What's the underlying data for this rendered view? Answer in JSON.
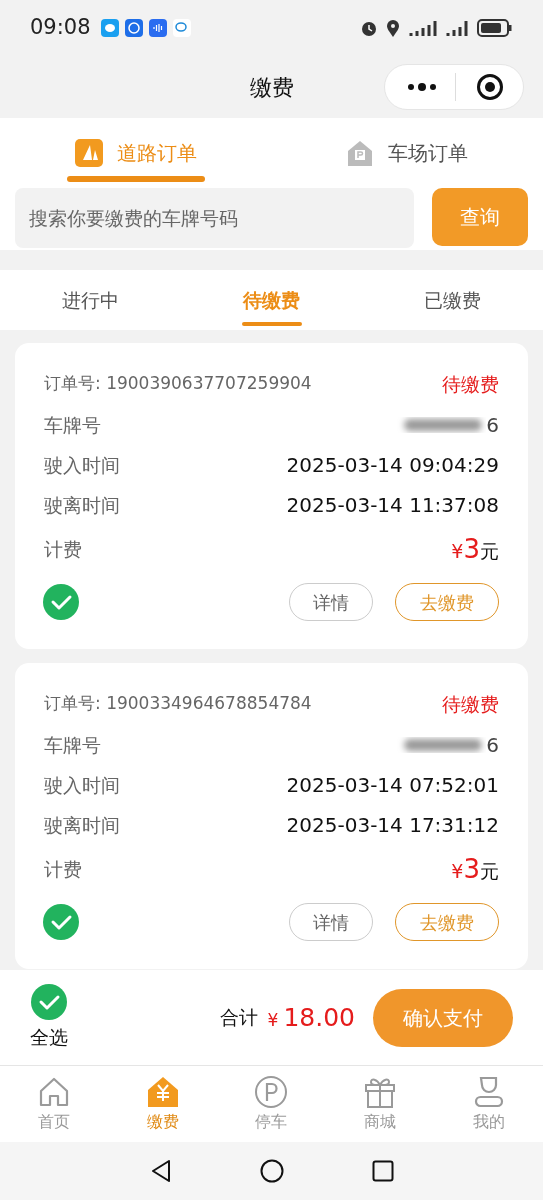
{
  "status_bar": {
    "time": "09:08"
  },
  "header": {
    "title": "缴费"
  },
  "order_tabs": [
    {
      "label": "道路订单",
      "selected": true
    },
    {
      "label": "车场订单",
      "selected": false
    }
  ],
  "search": {
    "placeholder": "搜索你要缴费的车牌号码",
    "button": "查询"
  },
  "status_tabs": [
    {
      "label": "进行中",
      "selected": false
    },
    {
      "label": "待缴费",
      "selected": true
    },
    {
      "label": "已缴费",
      "selected": false
    }
  ],
  "orders": [
    {
      "order_label": "订单号:",
      "order_no": "1900390637707259904",
      "status": "待缴费",
      "plate_label": "车牌号",
      "plate_visible": "6",
      "entry_label": "驶入时间",
      "entry_time": "2025-03-14 09:04:29",
      "exit_label": "驶离时间",
      "exit_time": "2025-03-14 11:37:08",
      "fee_label": "计费",
      "currency": "¥",
      "amount": "3",
      "unit": "元",
      "checked": true,
      "details_button": "详情",
      "pay_button": "去缴费"
    },
    {
      "order_label": "订单号:",
      "order_no": "1900334964678854784",
      "status": "待缴费",
      "plate_label": "车牌号",
      "plate_visible": "6",
      "entry_label": "驶入时间",
      "entry_time": "2025-03-14 07:52:01",
      "exit_label": "驶离时间",
      "exit_time": "2025-03-14 17:31:12",
      "fee_label": "计费",
      "currency": "¥",
      "amount": "3",
      "unit": "元",
      "checked": true,
      "details_button": "详情",
      "pay_button": "去缴费"
    }
  ],
  "footer": {
    "select_all": {
      "label": "全选",
      "checked": true
    },
    "total_label": "合计",
    "currency": "¥",
    "total": "18.00",
    "confirm_button": "确认支付"
  },
  "bottom_nav": [
    {
      "label": "首页",
      "kind": "home",
      "selected": false
    },
    {
      "label": "缴费",
      "kind": "pay",
      "selected": true
    },
    {
      "label": "停车",
      "kind": "parking",
      "selected": false
    },
    {
      "label": "商城",
      "kind": "gift",
      "selected": false
    },
    {
      "label": "我的",
      "kind": "user",
      "selected": false
    }
  ]
}
